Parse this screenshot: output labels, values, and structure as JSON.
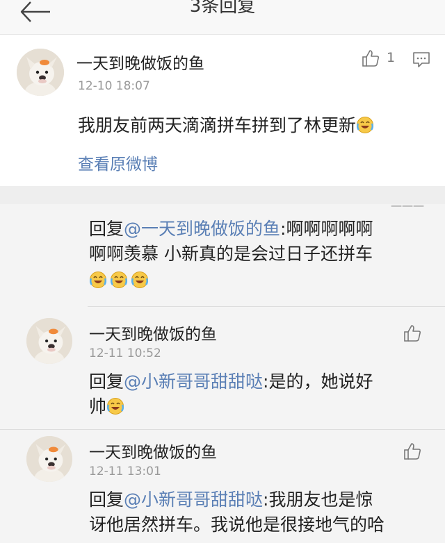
{
  "header": {
    "title": "3条回复"
  },
  "main_comment": {
    "author": "一天到晚做饭的鱼",
    "time": "12-10 18:07",
    "like_count": "1",
    "text": "我朋友前两天滴滴拼车拼到了林更新",
    "view_original": "查看原微博"
  },
  "replies": [
    {
      "prefix": "回复",
      "mention": "@一天到晚做饭的鱼",
      "line1_rest": ":啊啊啊啊啊",
      "line2": "啊啊羡慕 小新真的是会过日子还拼车"
    },
    {
      "author": "一天到晚做饭的鱼",
      "time": "12-11 10:52",
      "prefix": "回复",
      "mention": "@小新哥哥甜甜哒",
      "line1_rest": ":是的，她说好",
      "line2": "帅"
    },
    {
      "author": "一天到晚做饭的鱼",
      "time": "12-11 13:01",
      "prefix": "回复",
      "mention": "@小新哥哥甜甜哒",
      "line1_rest": ":我朋友也是惊",
      "line2": "讶他居然拼车。我说他是很接地气的哈"
    }
  ],
  "icons": {
    "back": "arrow-left-icon",
    "like": "thumbs-up-icon",
    "comment": "comment-icon",
    "emoji": "laugh-cry-emoji-icon"
  },
  "colors": {
    "link": "#5a7fb5",
    "timestamp": "#999999",
    "reply_bg": "#f4f4f4"
  }
}
